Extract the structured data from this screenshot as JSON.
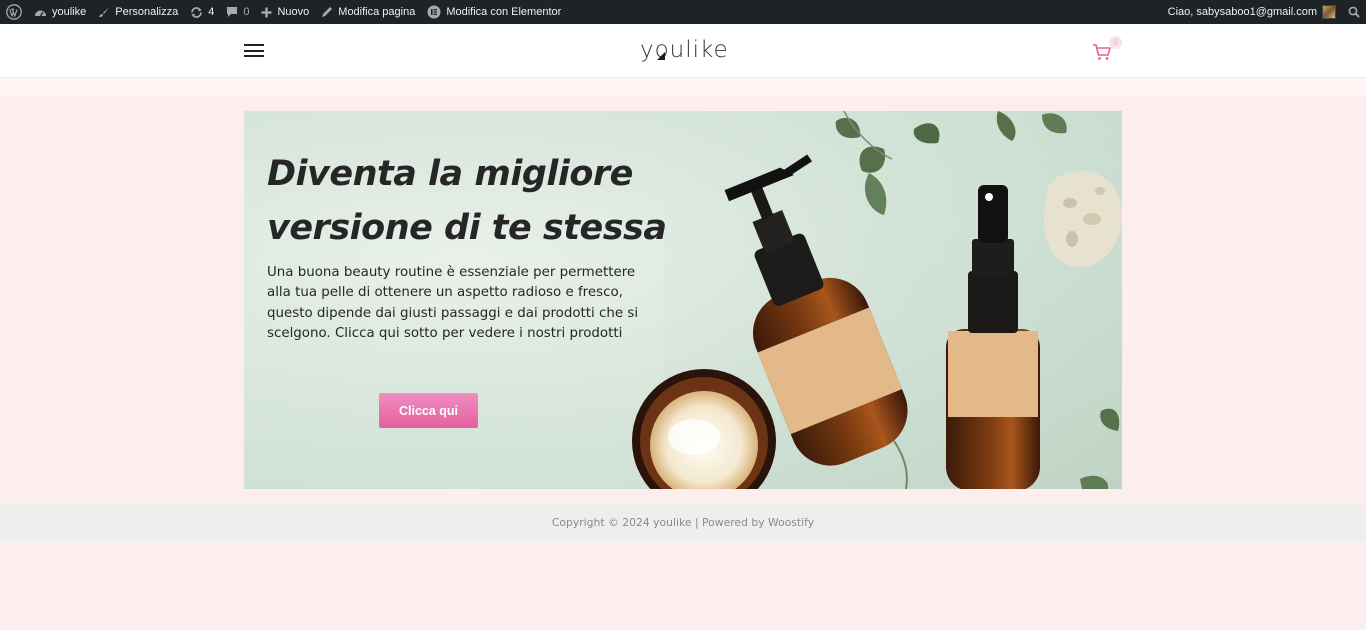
{
  "adminbar": {
    "site_name": "youlike",
    "customize": "Personalizza",
    "updates_count": "4",
    "comments_count": "0",
    "new": "Nuovo",
    "edit_page": "Modifica pagina",
    "edit_elementor": "Modifica con Elementor",
    "greeting": "Ciao, sabysaboo1@gmail.com"
  },
  "header": {
    "logo_text": "youlike",
    "cart_count": "0"
  },
  "hero": {
    "title_line1": "Diventa la migliore",
    "title_line2": "versione di te stessa",
    "text": "Una buona beauty routine è essenziale per permettere alla tua pelle di ottenere un aspetto radioso e fresco, questo dipende dai giusti passaggi e dai prodotti che si scelgono. Clicca qui sotto per vedere i nostri prodotti",
    "button_label": "Clicca qui"
  },
  "footer": {
    "text": "Copyright © 2024 youlike | Powered by Woostify"
  },
  "colors": {
    "accent": "#e3609e",
    "adminbar_bg": "#1d2327",
    "page_bg": "#fdeeee",
    "footer_bg": "#eeeeec"
  },
  "icons": [
    "wordpress-icon",
    "dashboard-icon",
    "brush-icon",
    "refresh-icon",
    "comment-icon",
    "plus-icon",
    "pencil-icon",
    "elementor-icon",
    "search-icon",
    "cart-icon",
    "hamburger-icon"
  ]
}
